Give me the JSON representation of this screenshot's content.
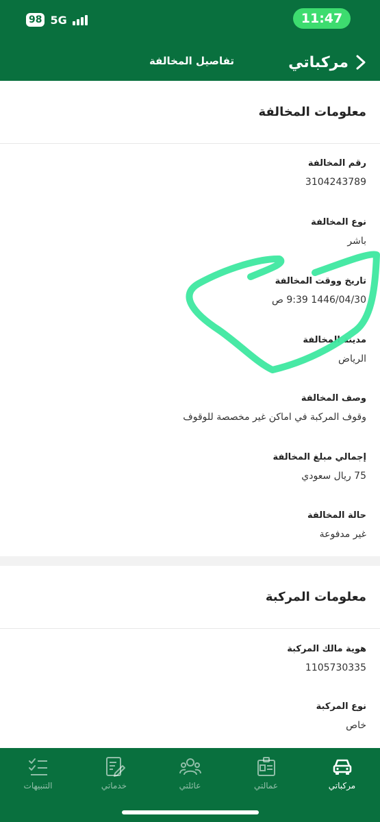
{
  "status": {
    "time": "11:47",
    "battery": "98",
    "network": "5G"
  },
  "nav": {
    "back_label": "مركباتي",
    "title": "تفاصيل المخالفة"
  },
  "violation": {
    "title": "معلومات المخالفة",
    "fields": [
      {
        "label": "رقم المخالفة",
        "value": "3104243789"
      },
      {
        "label": "نوع المخالفة",
        "value": "باشر"
      },
      {
        "label": "تاريخ ووقت المخالفة",
        "value": "1446/04/30 9:39 ص"
      },
      {
        "label": "مدينة المخالفة",
        "value": "الرياض"
      },
      {
        "label": "وصف المخالفة",
        "value": "وقوف المركبة في اماكن غير مخصصة للوقوف"
      },
      {
        "label": "إجمالي مبلغ المخالفة",
        "value": "75 ريال سعودي"
      },
      {
        "label": "حالة المخالفة",
        "value": "غير مدفوعة"
      }
    ]
  },
  "vehicle": {
    "title": "معلومات المركبة",
    "fields": [
      {
        "label": "هوية مالك المركبة",
        "value": "1105730335"
      },
      {
        "label": "نوع المركبة",
        "value": "خاص"
      }
    ]
  },
  "tabs": [
    {
      "label": "مركباتي",
      "icon": "car-icon",
      "active": true
    },
    {
      "label": "عمالتي",
      "icon": "id-card-icon",
      "active": false
    },
    {
      "label": "عائلتي",
      "icon": "family-icon",
      "active": false
    },
    {
      "label": "خدماتي",
      "icon": "document-edit-icon",
      "active": false
    },
    {
      "label": "التنبيهات",
      "icon": "checklist-icon",
      "active": false
    }
  ],
  "colors": {
    "brand": "#09703e",
    "time_pill": "#3ddc6f",
    "highlight": "#3ee8a0"
  }
}
